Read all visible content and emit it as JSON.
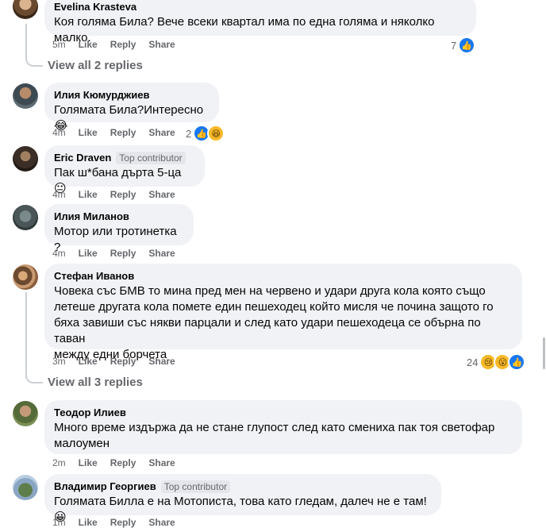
{
  "comments": [
    {
      "author": "Evelina Krasteva",
      "text": "Коя голяма Била? Вече всеки квартал има по една голяма и няколко малко.",
      "time": "5m",
      "like": "Like",
      "reply": "Reply",
      "share": "Share",
      "reactions": "7"
    },
    {
      "author": "Илия Кюмурджиев",
      "text": "Голямата Била?Интересно😂",
      "time": "4m",
      "like": "Like",
      "reply": "Reply",
      "share": "Share",
      "reactions": "2"
    },
    {
      "author": "Eric Draven",
      "badge": "Top contributor",
      "text": "Пак ш*бана дърта 5-ца 😐",
      "time": "4m",
      "like": "Like",
      "reply": "Reply",
      "share": "Share"
    },
    {
      "author": "Илия Миланов",
      "text": "Мотор или тротинетка ?",
      "time": "4m",
      "like": "Like",
      "reply": "Reply",
      "share": "Share"
    },
    {
      "author": "Стефан Иванов",
      "text_lines": [
        "Човека със БМВ то мина пред мен на червено и удари друга кола която също",
        "летеше другата кола помете един пешеходец който мисля че почина защото го",
        "бяха завиши със някви парцали и след като удари пешеходеца се обърна по таван",
        "между едни борчета"
      ],
      "time": "3m",
      "like": "Like",
      "reply": "Reply",
      "share": "Share",
      "reactions": "24"
    },
    {
      "author": "Теодор Илиев",
      "text_lines": [
        "Много време издържа да не стане глупост след като смениха пак тоя светофар",
        "малоумен"
      ],
      "time": "2m",
      "like": "Like",
      "reply": "Reply",
      "share": "Share"
    },
    {
      "author": "Владимир Георгиев",
      "badge": "Top contributor",
      "text": "Голямата Билла е на Мотописта, това като гледам, далеч не е там! 😀",
      "time": "1m",
      "like": "Like",
      "reply": "Reply",
      "share": "Share"
    }
  ],
  "view_replies_1": "View all 2 replies",
  "view_replies_2": "View all 3 replies",
  "colors": {
    "bubble": "#f0f2f5",
    "secondary_text": "#65676b",
    "like_blue": "#1877f2"
  }
}
